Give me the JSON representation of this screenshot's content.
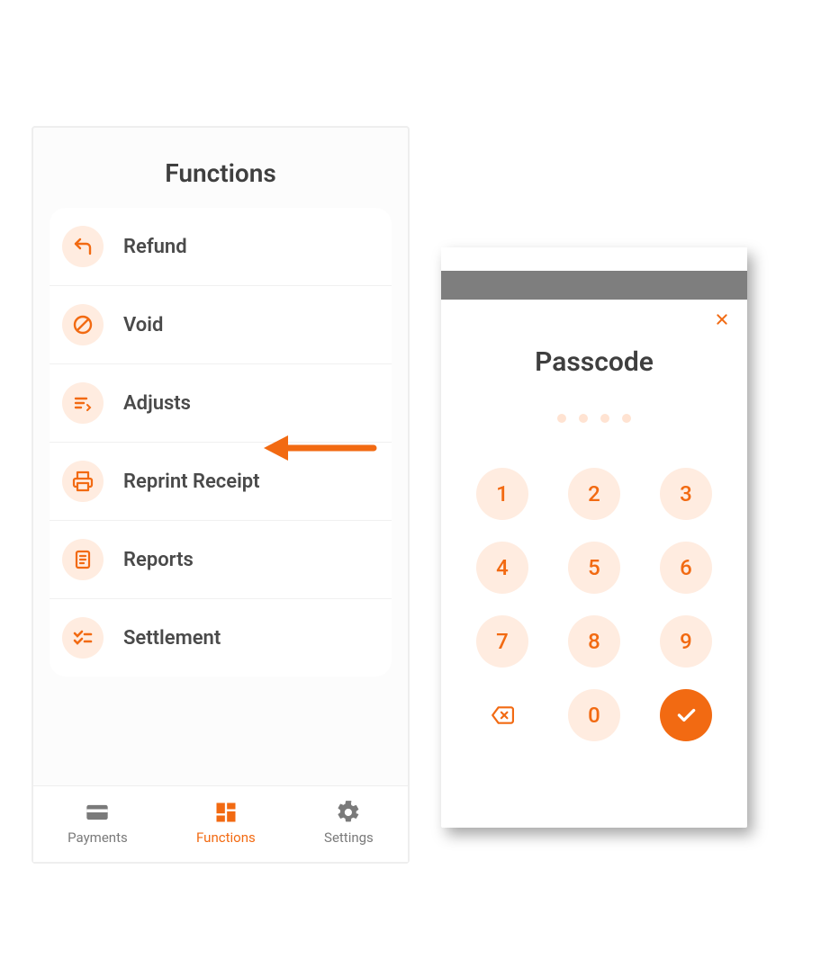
{
  "colors": {
    "accent": "#f26a12",
    "icon_bg": "#ffece0"
  },
  "functions_screen": {
    "title": "Functions",
    "items": [
      {
        "icon": "return-icon",
        "label": "Refund"
      },
      {
        "icon": "prohibit-icon",
        "label": "Void"
      },
      {
        "icon": "adjust-icon",
        "label": "Adjusts"
      },
      {
        "icon": "printer-icon",
        "label": "Reprint Receipt"
      },
      {
        "icon": "reports-icon",
        "label": "Reports"
      },
      {
        "icon": "checklist-icon",
        "label": "Settlement"
      }
    ],
    "nav": [
      {
        "icon": "card-icon",
        "label": "Payments",
        "active": false
      },
      {
        "icon": "grid-icon",
        "label": "Functions",
        "active": true
      },
      {
        "icon": "gear-icon",
        "label": "Settings",
        "active": false
      }
    ]
  },
  "annotation_arrow_target": "Adjusts",
  "passcode_screen": {
    "title": "Passcode",
    "pin_length": 4,
    "keys": [
      "1",
      "2",
      "3",
      "4",
      "5",
      "6",
      "7",
      "8",
      "9",
      "backspace",
      "0",
      "confirm"
    ]
  }
}
